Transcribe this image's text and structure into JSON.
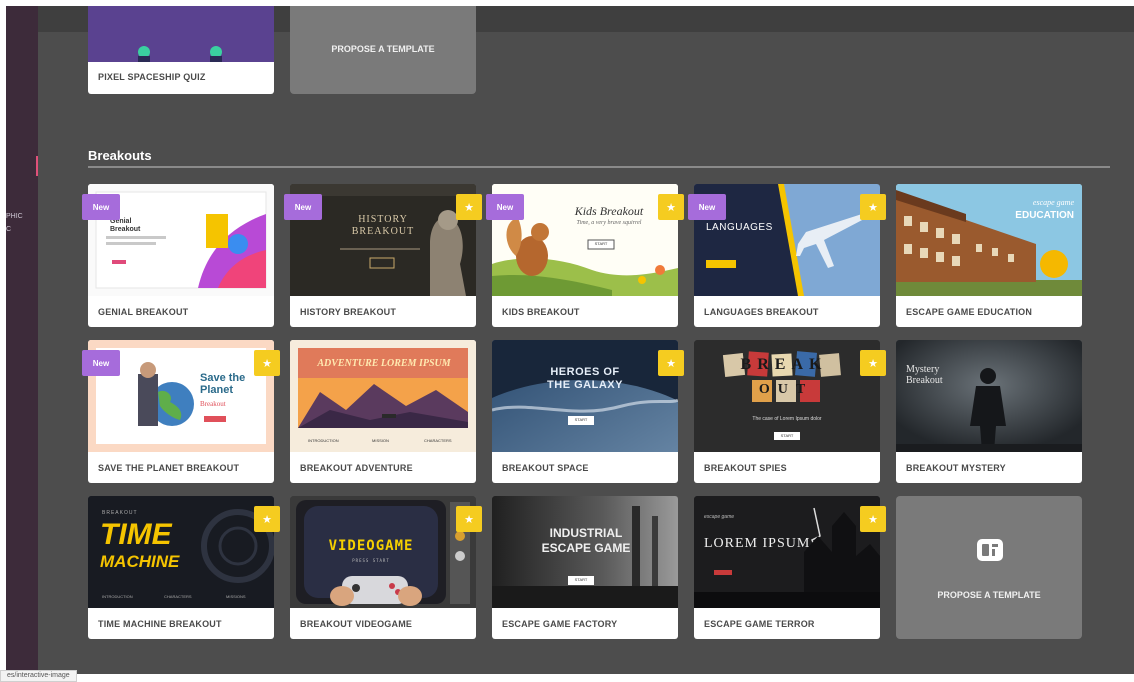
{
  "sidebar": {
    "stub_1": "PHIC",
    "stub_2": "C"
  },
  "previous_section": {
    "card": {
      "title": "PIXEL SPACESHIP QUIZ"
    },
    "propose_label": "PROPOSE A TEMPLATE"
  },
  "section": {
    "title": "Breakouts"
  },
  "badges": {
    "new": "New",
    "star": "★"
  },
  "cards": [
    {
      "title": "GENIAL BREAKOUT",
      "badges": [
        "new"
      ],
      "thumb": {
        "line1": "Genial",
        "line2": "Breakout"
      }
    },
    {
      "title": "HISTORY BREAKOUT",
      "badges": [
        "new",
        "premium"
      ],
      "thumb": {
        "line1": "HISTORY",
        "line2": "BREAKOUT"
      }
    },
    {
      "title": "KIDS BREAKOUT",
      "badges": [
        "new",
        "premium"
      ],
      "thumb": {
        "line1": "Kids Breakout",
        "line2": "Time, a very brave squirrel",
        "button": "START"
      }
    },
    {
      "title": "LANGUAGES BREAKOUT",
      "badges": [
        "new",
        "premium"
      ],
      "thumb": {
        "line1": "LANGUAGES"
      }
    },
    {
      "title": "ESCAPE GAME EDUCATION",
      "badges": [],
      "thumb": {
        "line1": "escape game",
        "line2": "EDUCATION"
      }
    },
    {
      "title": "SAVE THE PLANET BREAKOUT",
      "badges": [
        "new",
        "premium"
      ],
      "thumb": {
        "line1": "Save the",
        "line2": "Planet",
        "line3": "Breakout"
      }
    },
    {
      "title": "BREAKOUT ADVENTURE",
      "badges": [],
      "thumb": {
        "line1": "ADVENTURE LOREM IPSUM",
        "tabs": [
          "INTRODUCTION",
          "MISSION",
          "CHARACTERS"
        ]
      }
    },
    {
      "title": "BREAKOUT SPACE",
      "badges": [
        "premium"
      ],
      "thumb": {
        "line1": "HEROES OF",
        "line2": "THE GALAXY",
        "button": "START"
      }
    },
    {
      "title": "BREAKOUT SPIES",
      "badges": [
        "premium"
      ],
      "thumb": {
        "line1": "BREAK",
        "line2": "OUT",
        "line3": "The case of Lorem Ipsum dolor",
        "button": "START"
      }
    },
    {
      "title": "BREAKOUT MYSTERY",
      "badges": [],
      "thumb": {
        "line1": "Mystery",
        "line2": "Breakout"
      }
    },
    {
      "title": "TIME MACHINE BREAKOUT",
      "badges": [
        "premium"
      ],
      "thumb": {
        "line0": "BREAKOUT",
        "line1": "TIME",
        "line2": "MACHINE",
        "tabs": [
          "INTRODUCTION",
          "CHARACTERS",
          "MISSIONS"
        ]
      }
    },
    {
      "title": "BREAKOUT VIDEOGAME",
      "badges": [
        "premium"
      ],
      "thumb": {
        "line1": "VIDEOGAME",
        "line2": "PRESS START"
      }
    },
    {
      "title": "ESCAPE GAME FACTORY",
      "badges": [],
      "thumb": {
        "line1": "INDUSTRIAL",
        "line2": "ESCAPE GAME",
        "button": "START"
      }
    },
    {
      "title": "ESCAPE GAME TERROR",
      "badges": [
        "premium"
      ],
      "thumb": {
        "line1": "LOREM IPSUM",
        "line2": "escape game"
      }
    }
  ],
  "propose_card": {
    "label": "PROPOSE A TEMPLATE",
    "icon": "template-icon"
  },
  "status_bar": {
    "url": "es/interactive-image"
  },
  "colors": {
    "new_badge": "#a66cdb",
    "premium_badge": "#f5cc20",
    "background": "#4d4d4d"
  }
}
